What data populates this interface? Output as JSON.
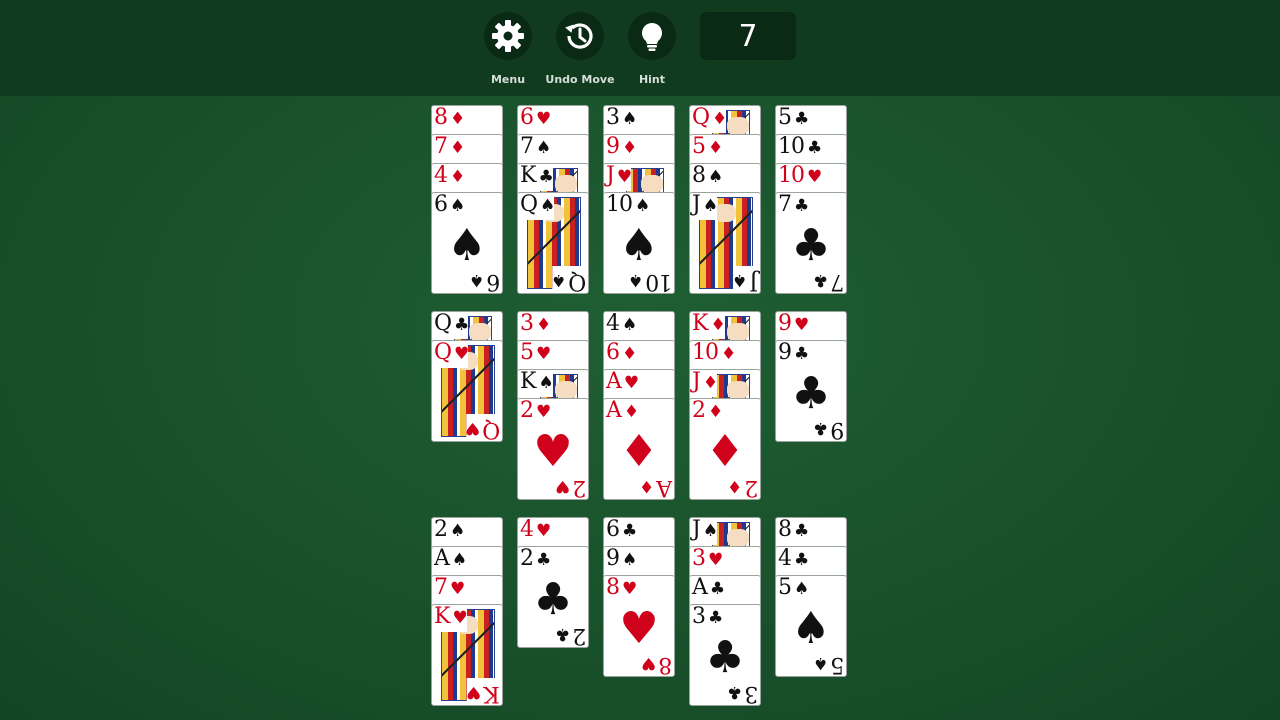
{
  "toolbar": {
    "menu_label": "Menu",
    "undo_label": "Undo Move",
    "hint_label": "Hint",
    "counter": "7"
  },
  "colors": {
    "felt": "#1a5530",
    "topbar": "#103b1f",
    "button_bg": "#0b2a16",
    "red_suit": "#d0021b",
    "black_suit": "#111111"
  },
  "piles": [
    {
      "cards": [
        {
          "rank": "8",
          "suit": "♦"
        },
        {
          "rank": "7",
          "suit": "♦"
        },
        {
          "rank": "4",
          "suit": "♦"
        },
        {
          "rank": "6",
          "suit": "♠"
        }
      ]
    },
    {
      "cards": [
        {
          "rank": "6",
          "suit": "♥"
        },
        {
          "rank": "7",
          "suit": "♠"
        },
        {
          "rank": "K",
          "suit": "♣"
        },
        {
          "rank": "Q",
          "suit": "♠"
        }
      ]
    },
    {
      "cards": [
        {
          "rank": "3",
          "suit": "♠"
        },
        {
          "rank": "9",
          "suit": "♦"
        },
        {
          "rank": "J",
          "suit": "♥"
        },
        {
          "rank": "10",
          "suit": "♠"
        }
      ]
    },
    {
      "cards": [
        {
          "rank": "Q",
          "suit": "♦"
        },
        {
          "rank": "5",
          "suit": "♦"
        },
        {
          "rank": "8",
          "suit": "♠"
        },
        {
          "rank": "J",
          "suit": "♠"
        }
      ]
    },
    {
      "cards": [
        {
          "rank": "5",
          "suit": "♣"
        },
        {
          "rank": "10",
          "suit": "♣"
        },
        {
          "rank": "10",
          "suit": "♥"
        },
        {
          "rank": "7",
          "suit": "♣"
        }
      ]
    },
    {
      "cards": [
        {
          "rank": "Q",
          "suit": "♣"
        },
        {
          "rank": "Q",
          "suit": "♥"
        }
      ]
    },
    {
      "cards": [
        {
          "rank": "3",
          "suit": "♦"
        },
        {
          "rank": "5",
          "suit": "♥"
        },
        {
          "rank": "K",
          "suit": "♠"
        },
        {
          "rank": "2",
          "suit": "♥"
        }
      ]
    },
    {
      "cards": [
        {
          "rank": "4",
          "suit": "♠"
        },
        {
          "rank": "6",
          "suit": "♦"
        },
        {
          "rank": "A",
          "suit": "♥"
        },
        {
          "rank": "A",
          "suit": "♦"
        }
      ]
    },
    {
      "cards": [
        {
          "rank": "K",
          "suit": "♦"
        },
        {
          "rank": "10",
          "suit": "♦"
        },
        {
          "rank": "J",
          "suit": "♦"
        },
        {
          "rank": "2",
          "suit": "♦"
        }
      ]
    },
    {
      "cards": [
        {
          "rank": "9",
          "suit": "♥"
        },
        {
          "rank": "9",
          "suit": "♣"
        }
      ]
    },
    {
      "cards": [
        {
          "rank": "2",
          "suit": "♠"
        },
        {
          "rank": "A",
          "suit": "♠"
        },
        {
          "rank": "7",
          "suit": "♥"
        },
        {
          "rank": "K",
          "suit": "♥"
        }
      ]
    },
    {
      "cards": [
        {
          "rank": "4",
          "suit": "♥"
        },
        {
          "rank": "2",
          "suit": "♣"
        }
      ]
    },
    {
      "cards": [
        {
          "rank": "6",
          "suit": "♣"
        },
        {
          "rank": "9",
          "suit": "♠"
        },
        {
          "rank": "8",
          "suit": "♥"
        }
      ]
    },
    {
      "cards": [
        {
          "rank": "J",
          "suit": "♠"
        },
        {
          "rank": "3",
          "suit": "♥"
        },
        {
          "rank": "A",
          "suit": "♣"
        },
        {
          "rank": "3",
          "suit": "♣"
        }
      ]
    },
    {
      "cards": [
        {
          "rank": "8",
          "suit": "♣"
        },
        {
          "rank": "4",
          "suit": "♣"
        },
        {
          "rank": "5",
          "suit": "♠"
        }
      ]
    }
  ]
}
